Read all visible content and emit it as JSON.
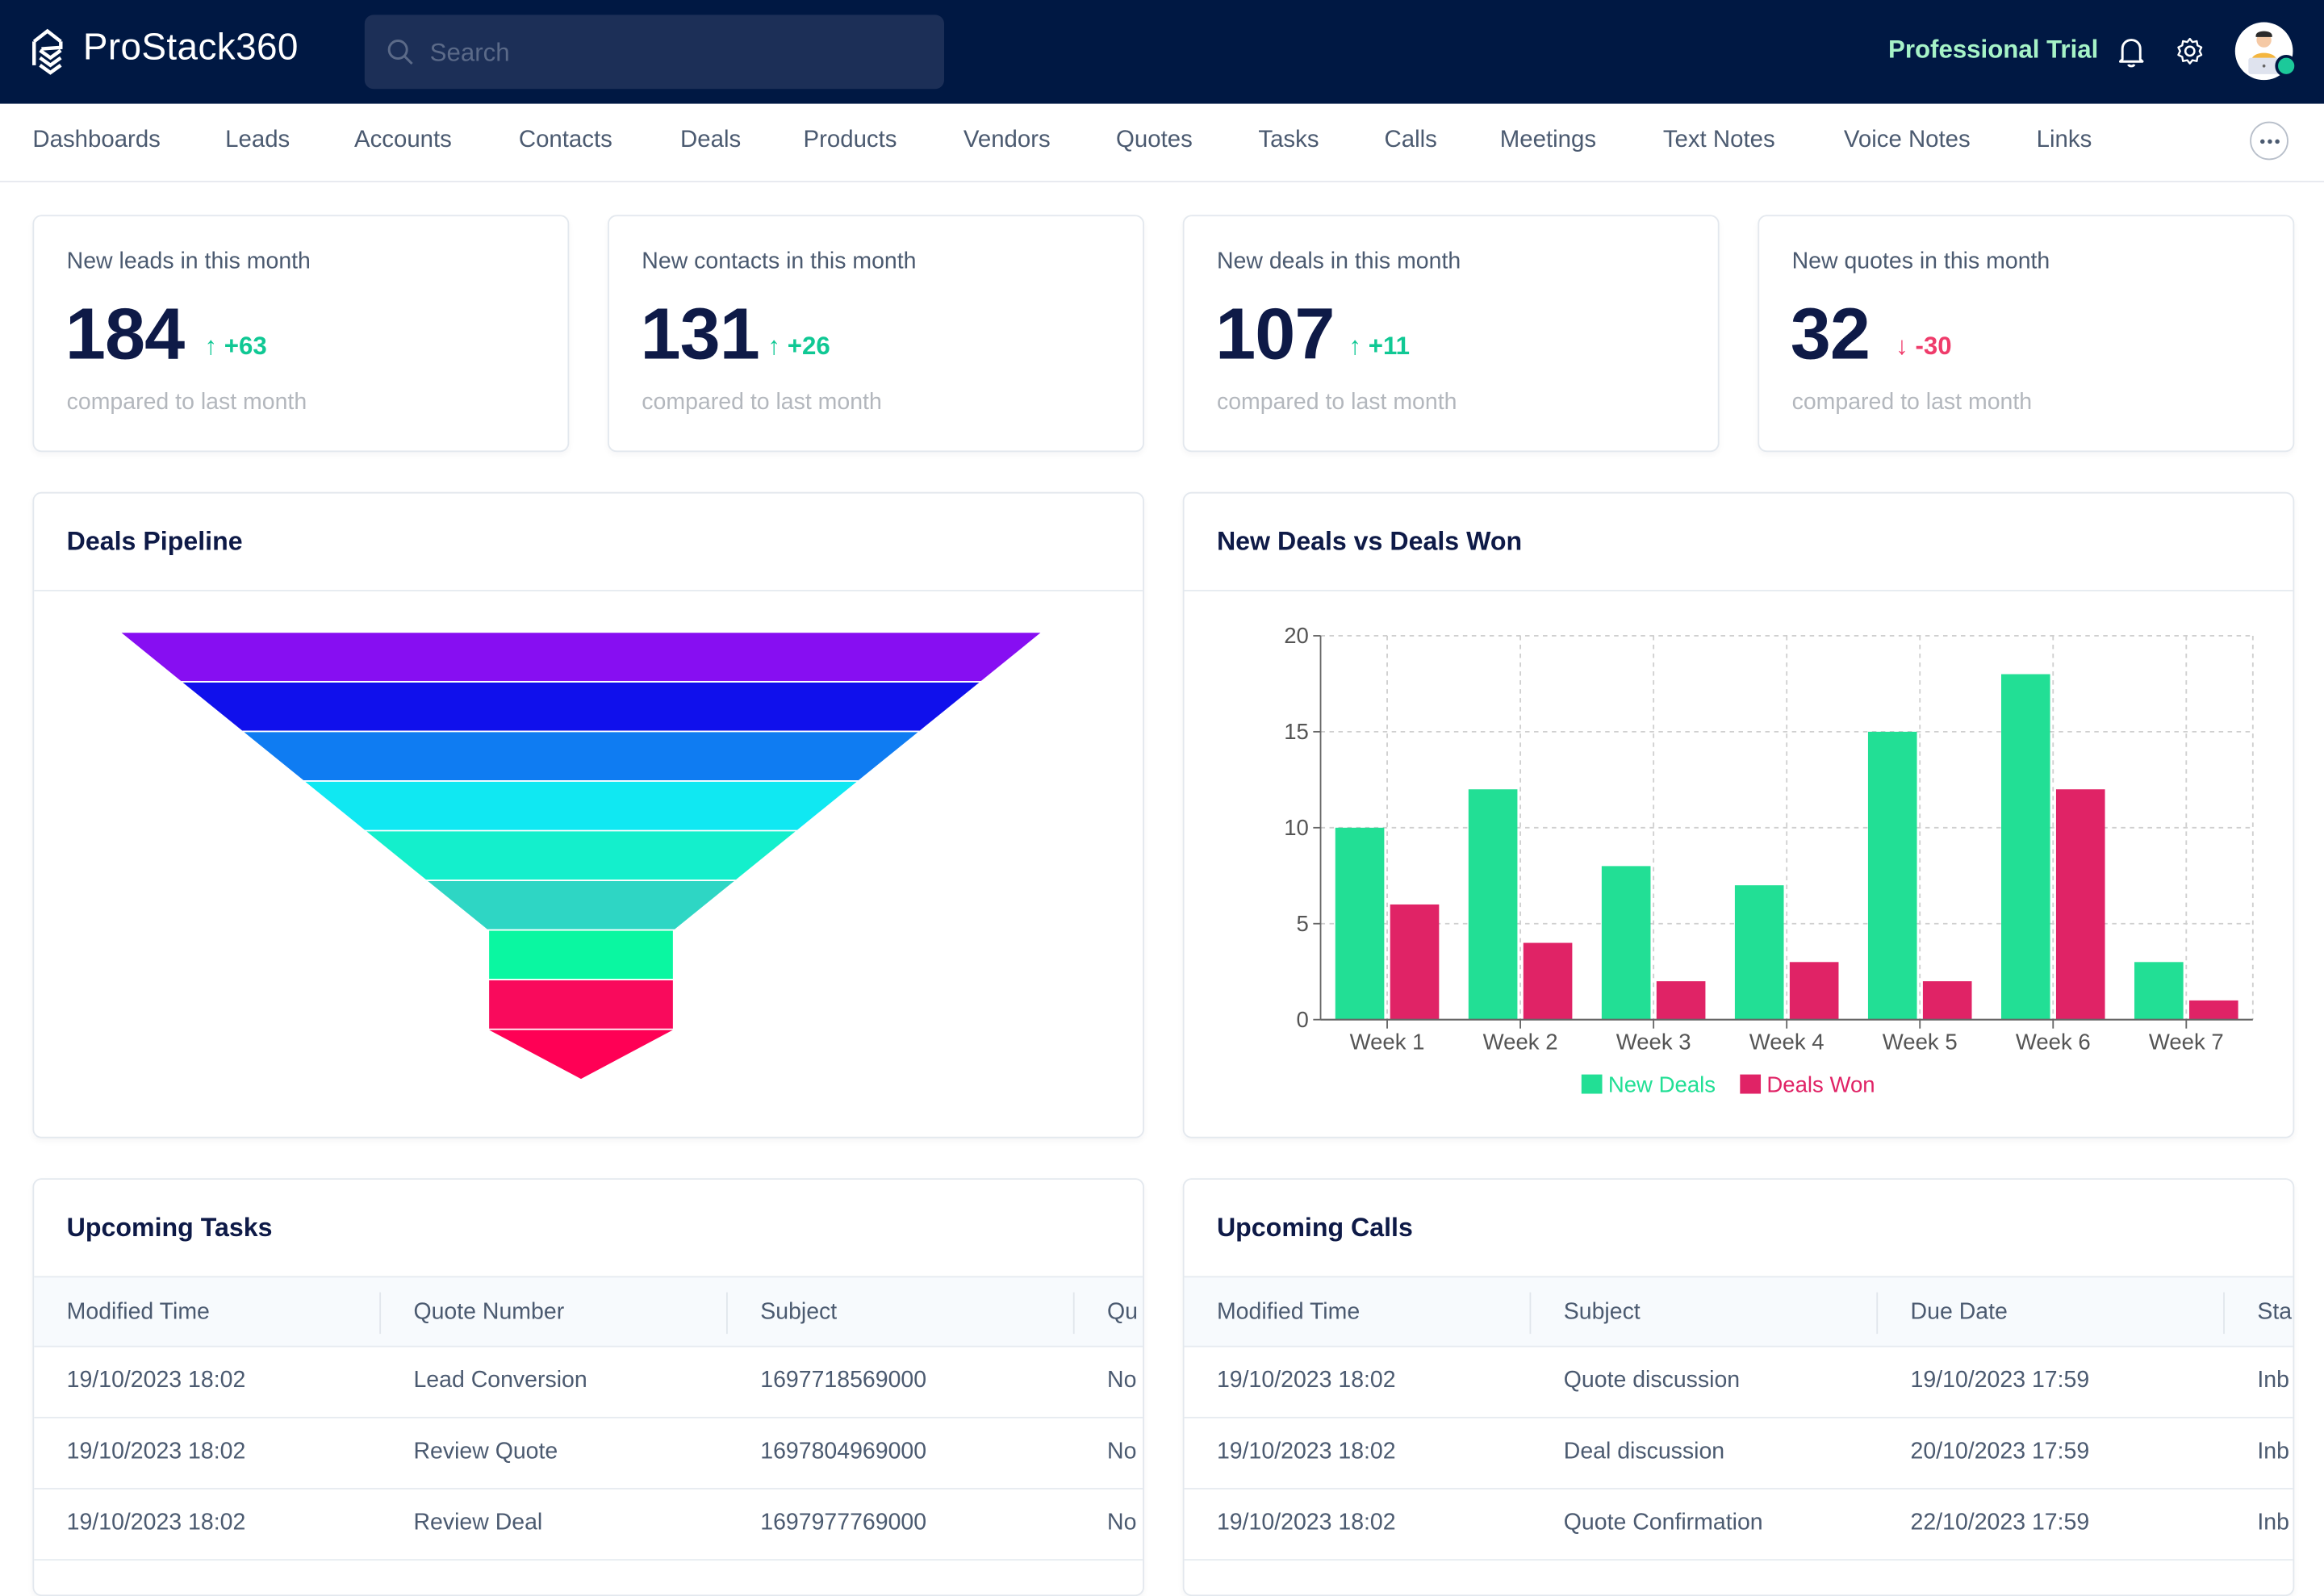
{
  "app": {
    "brand": "ProStack360",
    "search_placeholder": "Search",
    "plan_label": "Professional Trial",
    "icons": {
      "logo": "stacked-chevrons-logo-icon",
      "search": "search-icon",
      "notifications": "bell-icon",
      "settings": "gear-icon",
      "profile": "avatar",
      "more": "more-horizontal-icon"
    }
  },
  "nav": {
    "items": [
      "Dashboards",
      "Leads",
      "Accounts",
      "Contacts",
      "Deals",
      "Products",
      "Vendors",
      "Quotes",
      "Tasks",
      "Calls",
      "Meetings",
      "Text Notes",
      "Voice Notes",
      "Links"
    ]
  },
  "kpis": [
    {
      "label": "New leads in this month",
      "value": "184",
      "delta": "+63",
      "direction": "up",
      "compare": "compared to last month"
    },
    {
      "label": "New contacts in this month",
      "value": "131",
      "delta": "+26",
      "direction": "up",
      "compare": "compared to last month"
    },
    {
      "label": "New deals in this month",
      "value": "107",
      "delta": "+11",
      "direction": "up",
      "compare": "compared to last month"
    },
    {
      "label": "New quotes in this month",
      "value": "32",
      "delta": "-30",
      "direction": "down",
      "compare": "compared to last month"
    }
  ],
  "colors": {
    "up": "#10c894",
    "down": "#ef3c6b",
    "topbar": "#001843",
    "trial": "#a6f3c7"
  },
  "pipeline": {
    "title": "Deals Pipeline"
  },
  "deals_chart": {
    "title": "New Deals vs Deals Won"
  },
  "chart_data": [
    {
      "type": "funnel",
      "title": "Deals Pipeline",
      "stages": 9,
      "colors": [
        "#870ef2",
        "#1010ec",
        "#0f7cf2",
        "#10e8f2",
        "#14efcc",
        "#2ed6c4",
        "#0af7a1",
        "#f90a5c",
        "#ff0055"
      ],
      "labels_visible": false
    },
    {
      "type": "bar",
      "title": "New Deals vs Deals Won",
      "categories": [
        "Week 1",
        "Week 2",
        "Week 3",
        "Week 4",
        "Week 5",
        "Week 6",
        "Week 7"
      ],
      "series": [
        {
          "name": "New Deals",
          "color": "#22df95",
          "values": [
            10,
            12,
            8,
            7,
            15,
            18,
            3
          ]
        },
        {
          "name": "Deals Won",
          "color": "#e02366",
          "values": [
            6,
            4,
            2,
            3,
            2,
            12,
            1
          ]
        }
      ],
      "yticks": [
        "0",
        "5",
        "10",
        "15",
        "20"
      ],
      "ylim": [
        0,
        20
      ],
      "grid": true,
      "legend": "bottom-center",
      "xlabel": "",
      "ylabel": ""
    }
  ],
  "tasks": {
    "title": "Upcoming Tasks",
    "columns": [
      "Modified Time",
      "Quote Number",
      "Subject",
      "Qu"
    ],
    "rows": [
      [
        "19/10/2023 18:02",
        "Lead Conversion",
        "1697718569000",
        "No"
      ],
      [
        "19/10/2023 18:02",
        "Review Quote",
        "1697804969000",
        "No"
      ],
      [
        "19/10/2023 18:02",
        "Review Deal",
        "1697977769000",
        "No"
      ]
    ]
  },
  "calls": {
    "title": "Upcoming Calls",
    "columns": [
      "Modified Time",
      "Subject",
      "Due Date",
      "Sta"
    ],
    "rows": [
      [
        "19/10/2023 18:02",
        "Quote discussion",
        "19/10/2023 17:59",
        "Inb"
      ],
      [
        "19/10/2023 18:02",
        "Deal discussion",
        "20/10/2023 17:59",
        "Inb"
      ],
      [
        "19/10/2023 18:02",
        "Quote Confirmation",
        "22/10/2023 17:59",
        "Inb"
      ]
    ]
  }
}
